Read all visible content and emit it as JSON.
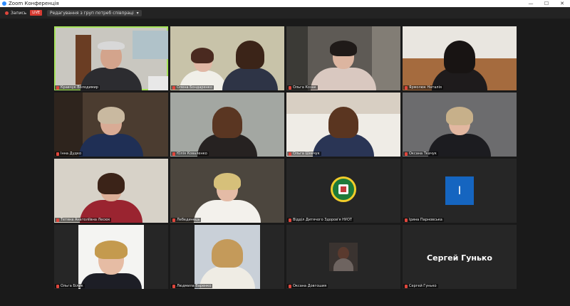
{
  "app": {
    "title": "Zoom Конференція",
    "window_controls": [
      "—",
      "☐",
      "✕"
    ]
  },
  "toolbar": {
    "record_label": "Запись",
    "live_label": "LIVE",
    "view_label": "Редагування з груп потреб співпраці",
    "view_chevron": "▾"
  },
  "participants": [
    {
      "name": "Кравчук Володимир",
      "active": true
    },
    {
      "name": "Олена Бондаренко"
    },
    {
      "name": "Ольга Козак"
    },
    {
      "name": "Ярмолюк Наталія"
    },
    {
      "name": "Інна Дудко"
    },
    {
      "name": "Юлія Коваленко"
    },
    {
      "name": "Ольга Шевчук"
    },
    {
      "name": "Оксана Ткачук"
    },
    {
      "name": "Тетяна Анатоліївна Лесюк"
    },
    {
      "name": "Лебединець"
    },
    {
      "name": "Відділ Дитячого Здоров'я НУОТ"
    },
    {
      "name": "Ірина Парновська",
      "initial": "I"
    },
    {
      "name": "Ольга Білик"
    },
    {
      "name": "Людмила Варенко"
    },
    {
      "name": "Оксана Довгошия"
    },
    {
      "name": "Сергей Гунько",
      "display_name": "Сергей Гунько"
    }
  ],
  "colors": {
    "active_speaker": "#a7e35b",
    "mic_muted": "#e0463c",
    "background": "#1a1a1a"
  }
}
